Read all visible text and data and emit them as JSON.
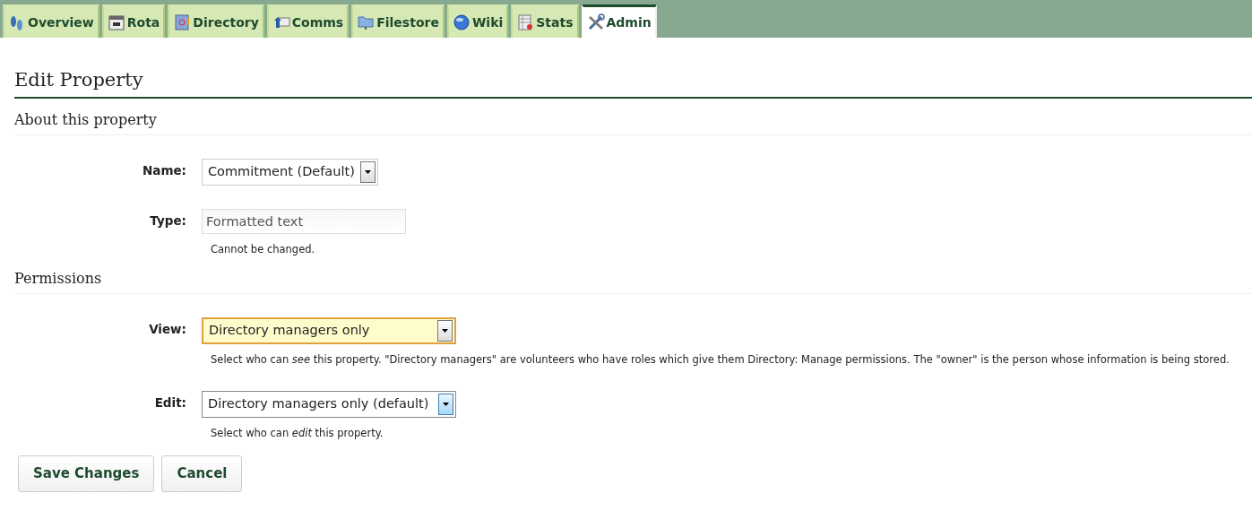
{
  "tabs": [
    {
      "label": "Overview",
      "selected": false
    },
    {
      "label": "Rota",
      "selected": false
    },
    {
      "label": "Directory",
      "selected": false
    },
    {
      "label": "Comms",
      "selected": false
    },
    {
      "label": "Filestore",
      "selected": false
    },
    {
      "label": "Wiki",
      "selected": false
    },
    {
      "label": "Stats",
      "selected": false
    },
    {
      "label": "Admin",
      "selected": true
    }
  ],
  "page_title": "Edit Property",
  "sections": [
    {
      "title": "About this property",
      "fields": [
        {
          "label": "Name:",
          "kind": "select",
          "value": "Commitment (Default)",
          "focused": false
        },
        {
          "label": "Type:",
          "kind": "readonly",
          "value": "Formatted text",
          "help": "Cannot be changed."
        }
      ]
    },
    {
      "title": "Permissions",
      "fields": [
        {
          "label": "View:",
          "kind": "select",
          "value": "Directory managers only",
          "focused": true,
          "help": "Select who can *see* this property. \"Directory managers\" are volunteers who have roles which give them Directory: Manage permissions. The \"owner\" is the person whose information is being stored."
        },
        {
          "label": "Edit:",
          "kind": "select",
          "value": "Directory managers only (default)",
          "focused": false,
          "hovered": true,
          "help": "Select who can *edit* this property."
        }
      ]
    }
  ],
  "buttons": [
    "Save Changes",
    "Cancel"
  ]
}
